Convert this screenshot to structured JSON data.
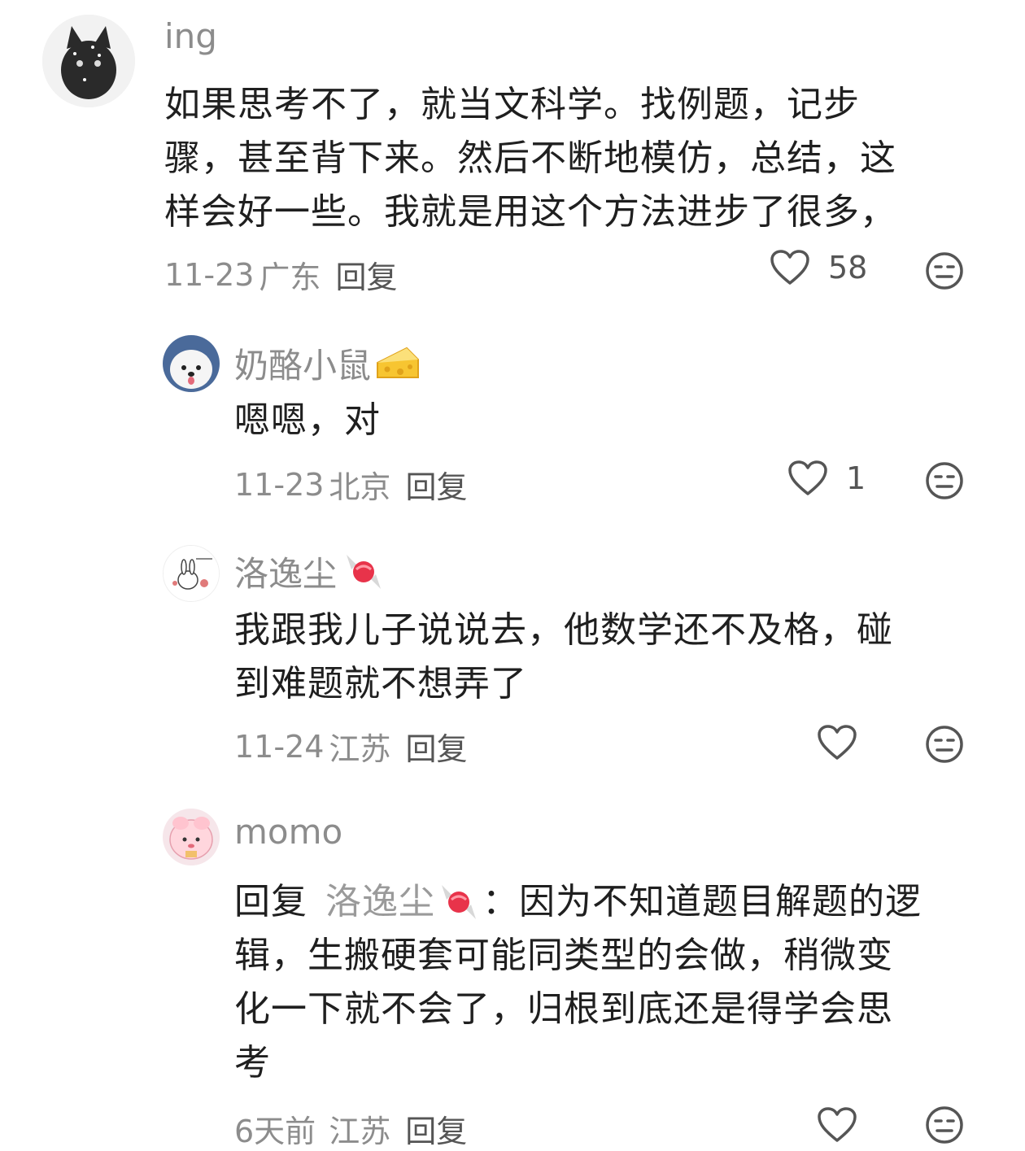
{
  "comments": [
    {
      "username": "ing",
      "text": "如果思考不了，就当文科学。找例题，记步骤，甚至背下来。然后不断地模仿，总结，这样会好一些。我就是用这个方法进步了很多，",
      "lines": [
        "如果思考不了，就当文科学。找例题，记步",
        "骤，甚至背下来。然后不断地模仿，总结，这",
        "样会好一些。我就是用这个方法进步了很多，"
      ],
      "date": "11-23",
      "location": "广东",
      "reply_label": "回复",
      "likes": "58"
    },
    {
      "username": "奶酪小鼠",
      "badge": "cheese-icon",
      "lines": [
        "嗯嗯，对"
      ],
      "date": "11-23",
      "location": "北京",
      "reply_label": "回复",
      "likes": "1"
    },
    {
      "username": "洛逸尘",
      "badge": "candy-icon",
      "lines": [
        "我跟我儿子说说去，他数学还不及格，碰",
        "到难题就不想弄了"
      ],
      "date": "11-24",
      "location": "江苏",
      "reply_label": "回复",
      "likes": ""
    },
    {
      "username": "momo",
      "reply_prefix": "回复",
      "reply_to": "洛逸尘",
      "reply_colon": "：",
      "first_line_rest": "因为不知道题目解题的逻",
      "lines": [
        "辑，生搬硬套可能同类型的会做，稍微变",
        "化一下就不会了，归根到底还是得学会思",
        "考"
      ],
      "date": "6天前",
      "location": "江苏",
      "reply_label": "回复",
      "likes": ""
    }
  ],
  "colors": {
    "text": "#1f1f1f",
    "muted": "#8c8c8c",
    "icon": "#555555"
  }
}
